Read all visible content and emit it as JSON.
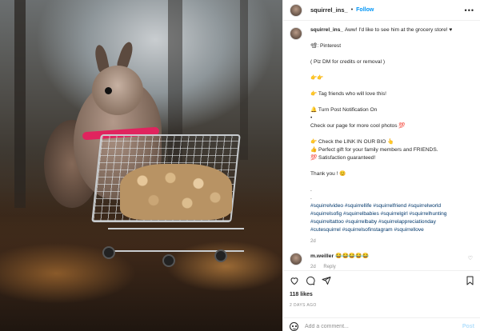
{
  "post": {
    "username": "squirrel_ins_",
    "separator": "•",
    "follow_label": "Follow",
    "more_icon": "more-horizontal-icon"
  },
  "caption": {
    "username": "squirrel_ins_",
    "first_line": "Aww! I'd like to see him at the grocery store! ♥",
    "lines": [
      "📽: Pinterest",
      "",
      "( Plz DM for credits or removal )",
      "",
      "👉👉",
      "",
      "👉 Tag friends who will love this!",
      "",
      "🔔 Turn Post Notification On",
      "•",
      "Check our page for more cool photos 💯",
      "",
      "👉 Check the LINK IN OUR BIO 👆",
      "👍 Perfect gift for your family members and FRIENDS.",
      "💯 Satisfaction guaranteed!",
      "",
      "Thank you ! 😊",
      "",
      ".",
      "."
    ],
    "hashtags": [
      "#squirrelvideo #squirrellife #squirrelfriend #squirrelworld",
      "#squirrelsofig #squirrelbabies #squirrelgirl #squirrelhunting",
      "#squirreltattoo #squirrelbaby #squirrelappreciationday",
      "#cutesquirrel #squirrelsofinstagram #squirrellove"
    ],
    "time": "2d"
  },
  "comments": [
    {
      "username": "m.weiller",
      "text": "😂😂😂😂😂",
      "time": "2d",
      "reply_label": "Reply"
    }
  ],
  "actions": {
    "like_icon": "heart-icon",
    "comment_icon": "comment-icon",
    "share_icon": "send-icon",
    "save_icon": "bookmark-icon"
  },
  "likes": "118 likes",
  "posted_ago": "2 DAYS AGO",
  "comment_box": {
    "emoji_icon": "smile-icon",
    "placeholder": "Add a comment...",
    "post_label": "Post"
  },
  "colors": {
    "accent": "#0095f6",
    "post_disabled": "#b2dffc",
    "hashtag": "#00376b",
    "secondary_text": "#8e8e8e"
  }
}
